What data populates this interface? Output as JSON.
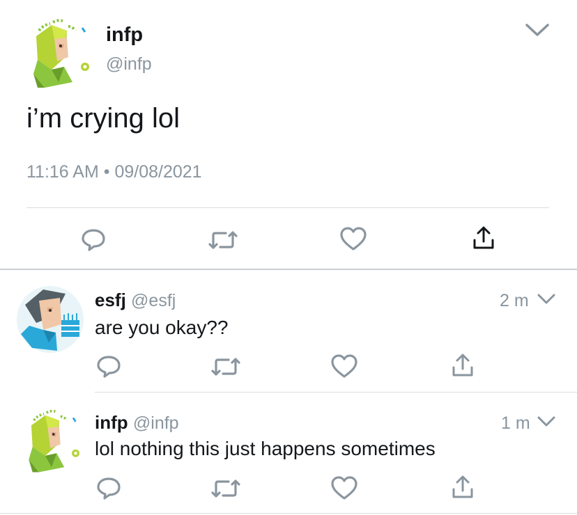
{
  "main_tweet": {
    "display_name": "infp",
    "handle": "@infp",
    "text": "i’m crying lol",
    "time": "11:16 AM",
    "separator": "•",
    "date": "09/08/2021",
    "avatar_icon": "infp-avatar-icon",
    "actions": [
      "reply-icon",
      "retweet-icon",
      "like-icon",
      "share-icon"
    ]
  },
  "replies": [
    {
      "display_name": "esfj",
      "handle": "@esfj",
      "time": "2 m",
      "text": "are you okay??",
      "avatar_icon": "esfj-avatar-icon"
    },
    {
      "display_name": "infp",
      "handle": "@infp",
      "time": "1 m",
      "text": "lol nothing this just happens sometimes",
      "avatar_icon": "infp-avatar-icon"
    }
  ],
  "colors": {
    "text": "#14171a",
    "secondary": "#8a959e",
    "icon": "#8a959e",
    "divider": "#d8dde1",
    "infp_green": "#8cc63f",
    "esfj_blue": "#2aa8d8"
  }
}
